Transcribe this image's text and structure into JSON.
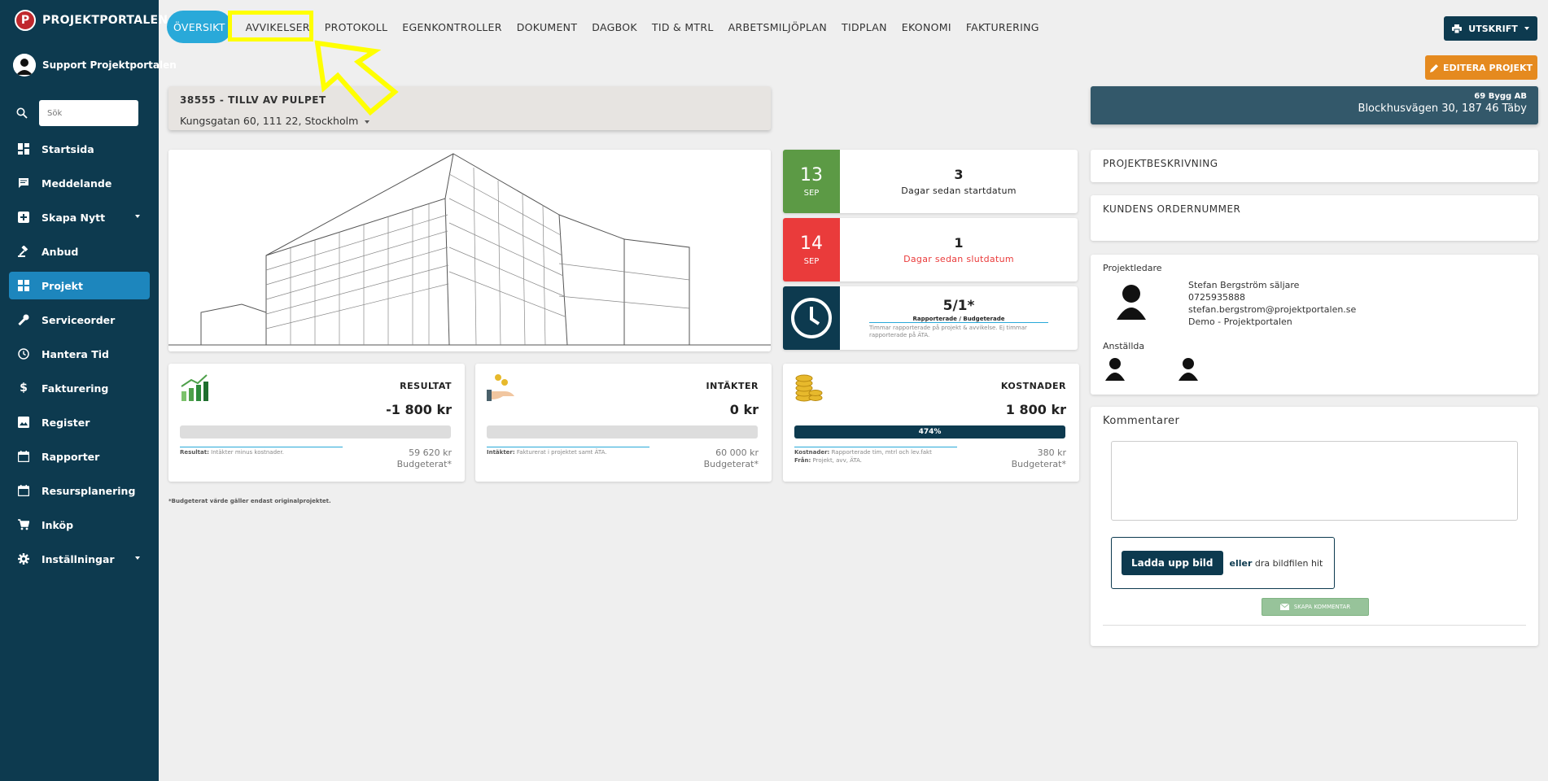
{
  "brand": {
    "name": "PROJEKTPORTALEN",
    "logo_letter": "P"
  },
  "user": {
    "name": "Support Projektportalen"
  },
  "search": {
    "placeholder": "Sök"
  },
  "sidebar": {
    "items": [
      {
        "label": "Startsida",
        "icon": "dashboard-icon"
      },
      {
        "label": "Meddelande",
        "icon": "message-icon"
      },
      {
        "label": "Skapa Nytt",
        "icon": "plus-icon",
        "caret": true
      },
      {
        "label": "Anbud",
        "icon": "gavel-icon"
      },
      {
        "label": "Projekt",
        "icon": "project-icon",
        "active": true
      },
      {
        "label": "Serviceorder",
        "icon": "wrench-icon"
      },
      {
        "label": "Hantera Tid",
        "icon": "clock-icon"
      },
      {
        "label": "Fakturering",
        "icon": "dollar-icon"
      },
      {
        "label": "Register",
        "icon": "image-icon"
      },
      {
        "label": "Rapporter",
        "icon": "calendar-icon"
      },
      {
        "label": "Resursplanering",
        "icon": "calendar-icon"
      },
      {
        "label": "Inköp",
        "icon": "cart-icon"
      },
      {
        "label": "Inställningar",
        "icon": "gear-icon",
        "caret": true
      }
    ]
  },
  "tabs": [
    "ÖVERSIKT",
    "AVVIKELSER",
    "PROTOKOLL",
    "EGENKONTROLLER",
    "DOKUMENT",
    "DAGBOK",
    "TID & MTRL",
    "ARBETSMILJÖPLAN",
    "TIDPLAN",
    "EKONOMI",
    "FAKTURERING"
  ],
  "buttons": {
    "print": "UTSKRIFT",
    "edit": "EDITERA PROJEKT"
  },
  "project": {
    "title": "38555 - TILLV AV PULPET",
    "address": "Kungsgatan 60, 111 22, Stockholm"
  },
  "client": {
    "name": "69 Bygg AB",
    "address": "Blockhusvägen 30, 187 46 Täby"
  },
  "start": {
    "day": "13",
    "month": "SEP",
    "count": "3",
    "label": "Dagar sedan startdatum"
  },
  "end": {
    "day": "14",
    "month": "SEP",
    "count": "1",
    "label": "Dagar sedan slutdatum"
  },
  "hours": {
    "value": "5/1*",
    "label": "Rapporterade / Budgeterade",
    "note": "Timmar rapporterade på projekt & avvikelse. Ej timmar rapporterade på ÄTA."
  },
  "stats": [
    {
      "title": "RESULTAT",
      "value": "-1 800 kr",
      "fill": 0.0,
      "fill_label": "",
      "note_bold": "Resultat:",
      "note": "Intäkter minus kostnader.",
      "note2_bold": "",
      "note2": "",
      "budget": "59 620 kr",
      "budget_label": "Budgeterat*"
    },
    {
      "title": "INTÄKTER",
      "value": "0 kr",
      "fill": 0.0,
      "fill_label": "",
      "note_bold": "Intäkter:",
      "note": "Fakturerat i projektet samt ÄTA.",
      "note2_bold": "",
      "note2": "",
      "budget": "60 000 kr",
      "budget_label": "Budgeterat*"
    },
    {
      "title": "KOSTNADER",
      "value": "1 800 kr",
      "fill": 1.0,
      "fill_label": "474%",
      "note_bold": "Kostnader:",
      "note": "Rapporterade tim, mtrl och lev.fakt",
      "note2_bold": "Från:",
      "note2": "Projekt, avv, ÄTA.",
      "budget": "380 kr",
      "budget_label": "Budgeterat*"
    }
  ],
  "footnote": "*Budgeterat värde gäller endast originalprojektet.",
  "right": {
    "description_header": "PROJEKTBESKRIVNING",
    "order_header": "KUNDENS ORDERNUMMER",
    "pm_label": "Projektledare",
    "pm_name": "Stefan Bergström säljare",
    "pm_phone": "0725935888",
    "pm_email": "stefan.bergstrom@projektportalen.se",
    "pm_company": "Demo - Projektportalen",
    "employees_label": "Anställda",
    "comments_header": "Kommentarer",
    "upload_button": "Ladda upp bild",
    "upload_or": "eller",
    "upload_text": "dra bildfilen hit",
    "create_comment": "SKAPA KOMMENTAR"
  },
  "colors": {
    "sidebar": "#0d3a4f",
    "active": "#1d86bd",
    "tab_active": "#29a9d9",
    "green": "#5c9a45",
    "red": "#ea3b3b",
    "orange": "#e58a1f",
    "highlight": "#ffff00"
  }
}
